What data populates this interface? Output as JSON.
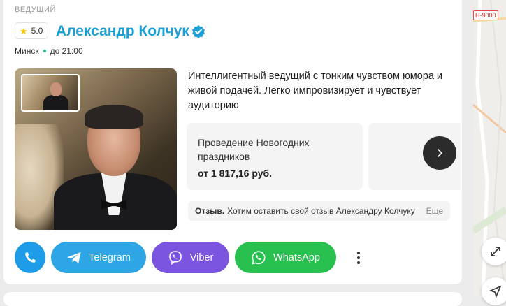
{
  "listing": {
    "category": "ВЕДУЩИЙ",
    "rating": "5.0",
    "name": "Александр Колчук",
    "city": "Минск",
    "hours": "до 21:00",
    "description": "Интеллигентный ведущий с тонким чувством юмора и живой подачей. Легко импровизирует и чувствует аудиторию"
  },
  "service": {
    "title": "Проведение Новогодних праздников",
    "price": "от 1 817,16 руб."
  },
  "review": {
    "label": "Отзыв.",
    "text": "Хотим оставить свой отзыв Александру Колчуку",
    "more": "Еще"
  },
  "contacts": {
    "telegram": "Telegram",
    "viber": "Viber",
    "whatsapp": "WhatsApp"
  },
  "map": {
    "road_label": "Н-9000"
  },
  "colors": {
    "accent": "#1b9fd6",
    "telegram": "#2ea6e6",
    "viber": "#7b55e0",
    "whatsapp": "#28c14f",
    "phone": "#1e9ce8"
  },
  "icons": [
    "star-icon",
    "verified-icon",
    "chevron-right-icon",
    "phone-icon",
    "telegram-icon",
    "viber-icon",
    "whatsapp-icon",
    "more-vertical-icon",
    "expand-icon",
    "navigate-icon"
  ]
}
